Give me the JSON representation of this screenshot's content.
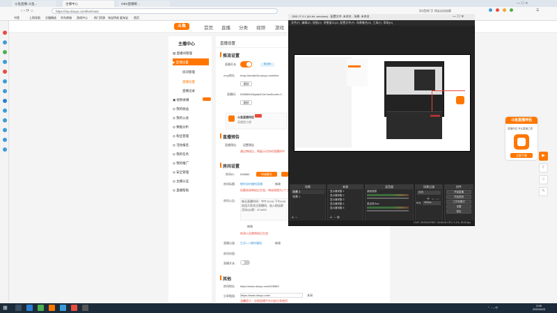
{
  "browser": {
    "tabs": [
      {
        "label": "斗鱼直播-斗鱼..."
      },
      {
        "label": "主播中心"
      },
      {
        "label": "OBS直播姬..."
      }
    ],
    "url": "https://mp.douyu.com/live/main",
    "bookmarks": [
      "书签",
      "上网导航",
      "天猫精选",
      "京东商城",
      "游戏中心",
      "热门资源",
      "淘宝特卖",
      "爱淘宝",
      "首页"
    ],
    "top_right_text": "【抖音热门】网友自动加载"
  },
  "site": {
    "logo": "斗鱼",
    "nav": [
      "首页",
      "直播",
      "分类",
      "视频",
      "游戏"
    ]
  },
  "sidebar": {
    "title": "主播中心",
    "items": [
      {
        "label": "直播间管理"
      },
      {
        "label": "直播设置",
        "active": true
      },
      {
        "label": "房间管理"
      },
      {
        "label": "直播设置"
      },
      {
        "label": "直播记录"
      },
      {
        "label": "视频录播"
      },
      {
        "label": "我的收益"
      },
      {
        "label": "我的公会"
      },
      {
        "label": "数据分析"
      },
      {
        "label": "粉丝管理"
      },
      {
        "label": "活动报名"
      },
      {
        "label": "我的任务"
      },
      {
        "label": "我的推广"
      },
      {
        "label": "安全管理"
      },
      {
        "label": "主播认证"
      },
      {
        "label": "直播帮助"
      }
    ]
  },
  "content": {
    "page_title": "直播设置",
    "sec1_title": "推流设置",
    "live_switch_label": "直播开关:",
    "rtmp_label": "rtmp地址:",
    "rtmp_value": "rtmp://sendtc3a.douyu.com/live",
    "copy_label": "复制",
    "key_label": "直播码:",
    "key_value": "528583rDMya6A7de?wsSecret=f...",
    "promo_title": "斗鱼直播伴侣",
    "promo_sub": "直播更方便",
    "sec2_title": "直播预告",
    "preview_label": "直播预告:",
    "preview_btn": "设置预告",
    "preview_note": "通过审核后，将展示在你的直播间中",
    "sec3_title": "房间设置",
    "room_id_label": "房间ID:",
    "room_id": "528583",
    "apply_btn": "申请靓号",
    "room_title_label": "房间标题:",
    "room_title": "教你如何赚钱直播",
    "edit": "修改",
    "title_note": "标题修改审核后生效，审核周期为1个工作日",
    "notice_label": "房间公告:",
    "notice_text": "每天直播时间：中午12:00-下午6:00\n欢迎大家关注直播间，加入粉丝群\n活动QQ群：574493",
    "notice_note": "修改公告需审核后生效",
    "category_label": "直播分类:",
    "category": "生活>>>教你赚钱",
    "cover_label": "房间封面:",
    "vr_label": "直播开关:",
    "sec4_title": "其他",
    "room_url_label": "房间地址:",
    "room_url": "https://www.douyu.com/528583",
    "share_label": "分享链接:",
    "share_value": "https://www.douyu.com/",
    "share_btn": "关闭",
    "share_note": "温馨提示：仅限直播平台内部分享使用"
  },
  "obs": {
    "title": "OBS 27.0.1 (64-bit, windows) - 配置文件: 未命名 - 场景: 未命名",
    "menu": [
      "文件(F)",
      "编辑(E)",
      "视图(V)",
      "停靠窗口(D)",
      "配置文件(P)",
      "场景集合(S)",
      "工具(T)",
      "帮助(H)"
    ],
    "docks": {
      "scenes": "场景",
      "sources": "来源",
      "mixer": "混音器",
      "transitions": "场景过渡",
      "controls": "控件"
    },
    "scene_items": [
      "场景 2",
      "场景 1"
    ],
    "source_items": [
      "显示器采集 1",
      "显示器采集 2",
      "显示器采集 3",
      "显示器采集 4",
      "显示器采集 5"
    ],
    "mixer_items": [
      "桌面音频",
      "麦克风/Aux"
    ],
    "transition_value": "淡出",
    "duration_label": "时长",
    "duration_value": "300ms",
    "control_buttons": [
      "开始直播",
      "开始录制",
      "工作室模式",
      "设置",
      "退出"
    ],
    "status": "LIVE: 00:00:00  REC: 00:00:00  CPU: 2.1%, 30.00 fps"
  },
  "promo_panel": {
    "title": "斗鱼直播伴侣",
    "sub": "直播伴侣 专业直播工具",
    "btn": "立即下载"
  },
  "taskbar": {
    "time": "2:06",
    "date": "2021/9/23"
  },
  "colors": {
    "accent": "#ff7700",
    "warning_red": "#e74c3c",
    "obs_bg": "#232323"
  }
}
